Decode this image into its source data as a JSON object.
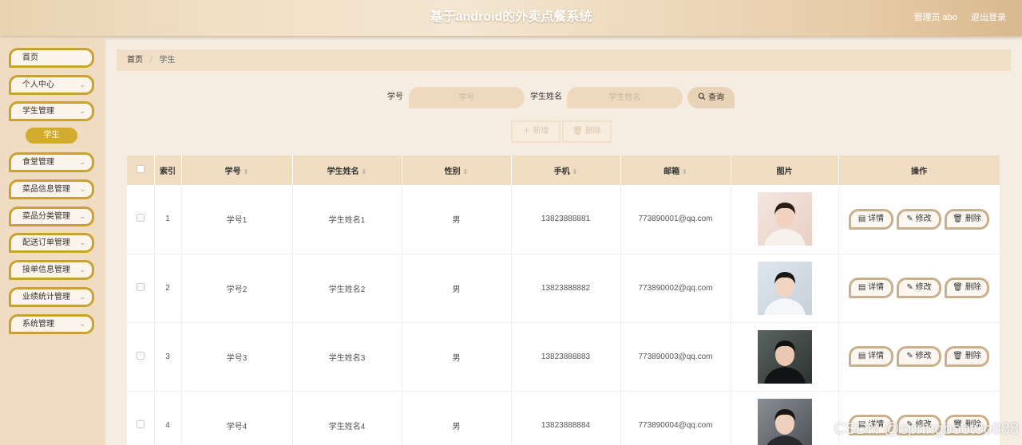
{
  "header": {
    "title": "基于android的外卖点餐系统",
    "admin_label": "管理员 abo",
    "logout_label": "退出登录"
  },
  "sidebar": {
    "items": [
      {
        "label": "首页",
        "has_arrow": false
      },
      {
        "label": "个人中心",
        "has_arrow": true
      },
      {
        "label": "学生管理",
        "has_arrow": true
      },
      {
        "label": "食堂管理",
        "has_arrow": true
      },
      {
        "label": "菜品信息管理",
        "has_arrow": true
      },
      {
        "label": "菜品分类管理",
        "has_arrow": true
      },
      {
        "label": "配送订单管理",
        "has_arrow": true
      },
      {
        "label": "接单信息管理",
        "has_arrow": true
      },
      {
        "label": "业绩统计管理",
        "has_arrow": true
      },
      {
        "label": "系统管理",
        "has_arrow": true
      }
    ],
    "active_sub": "学生",
    "chevron": "⌄"
  },
  "breadcrumb": {
    "home": "首页",
    "separator": "/",
    "current": "学生"
  },
  "search": {
    "field1_label": "学号",
    "field1_placeholder": "学号",
    "field2_label": "学生姓名",
    "field2_placeholder": "学生姓名",
    "button_label": "查询",
    "search_icon": "search-icon"
  },
  "actions": {
    "add_label": "新增",
    "add_icon": "plus-icon",
    "delete_label": "删除",
    "delete_icon": "trash-icon"
  },
  "table": {
    "columns": [
      "索引",
      "学号",
      "学生姓名",
      "性别",
      "手机",
      "邮箱",
      "图片",
      "操作"
    ],
    "sortable": [
      false,
      true,
      true,
      true,
      true,
      true,
      false,
      false
    ],
    "rows": [
      {
        "index": "1",
        "student_no": "学号1",
        "name": "学生姓名1",
        "gender": "男",
        "phone": "13823888881",
        "email": "773890001@qq.com",
        "photo": "portrait-photo-1"
      },
      {
        "index": "2",
        "student_no": "学号2",
        "name": "学生姓名2",
        "gender": "男",
        "phone": "13823888882",
        "email": "773890002@qq.com",
        "photo": "portrait-photo-2"
      },
      {
        "index": "3",
        "student_no": "学号3",
        "name": "学生姓名3",
        "gender": "男",
        "phone": "13823888883",
        "email": "773890003@qq.com",
        "photo": "portrait-photo-3"
      },
      {
        "index": "4",
        "student_no": "学号4",
        "name": "学生姓名4",
        "gender": "男",
        "phone": "13823888884",
        "email": "773890004@qq.com",
        "photo": "portrait-photo-4"
      }
    ],
    "row_actions": {
      "detail_label": "详情",
      "edit_label": "修改",
      "delete_label": "删除"
    }
  },
  "watermark": "CSDN @springboot0o888",
  "colors": {
    "accent": "#c9a233",
    "active_sub_bg": "#d2ac2c",
    "header_bg": "#efdcc0",
    "table_header_bg": "#f1ddc2",
    "page_bg": "#f6ede2"
  }
}
